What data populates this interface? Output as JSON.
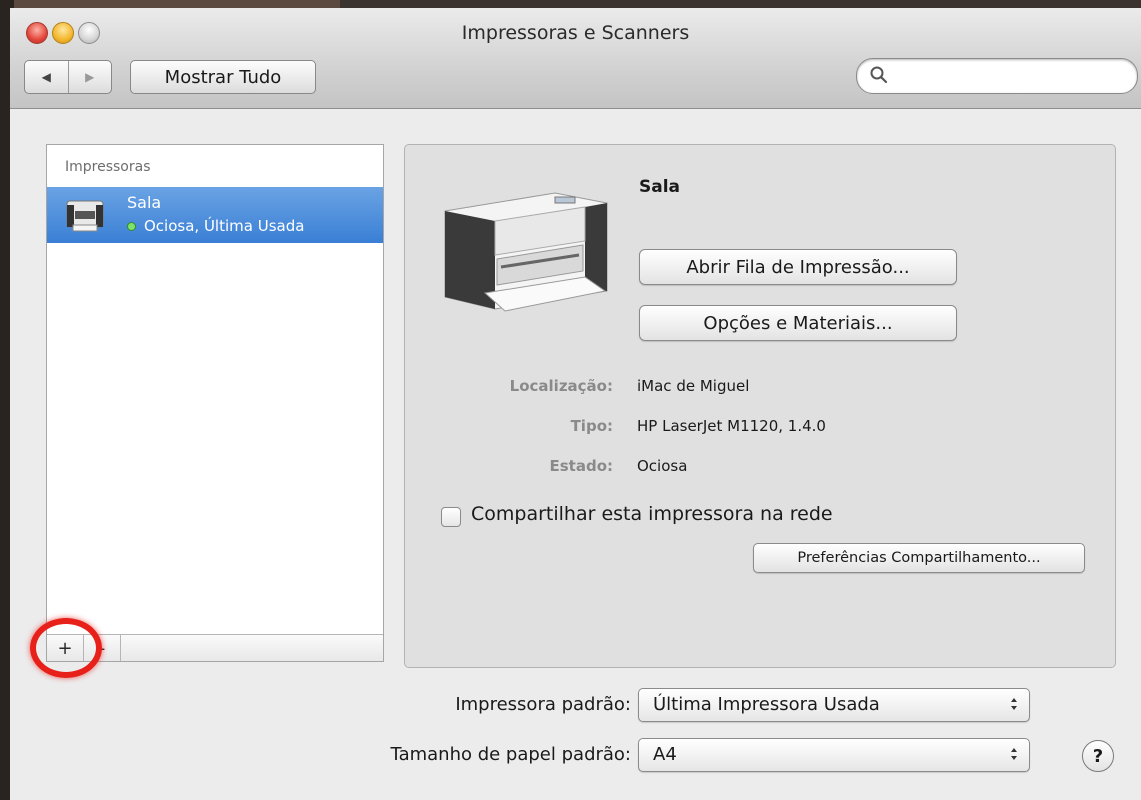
{
  "window": {
    "title": "Impressoras e Scanners"
  },
  "toolbar": {
    "back_icon": "◀",
    "forward_icon": "▶",
    "show_all_label": "Mostrar Tudo",
    "search_placeholder": "",
    "search_value": ""
  },
  "sidebar": {
    "header": "Impressoras",
    "items": [
      {
        "name": "Sala",
        "status": "Ociosa, Última Usada",
        "status_color": "#7ce36a"
      }
    ],
    "add_label": "+",
    "remove_label": "-"
  },
  "detail": {
    "name": "Sala",
    "open_queue_label": "Abrir Fila de Impressão...",
    "options_label": "Opções e Materiais...",
    "info": [
      {
        "label": "Localização:",
        "value": "iMac de Miguel"
      },
      {
        "label": "Tipo:",
        "value": "HP LaserJet M1120, 1.4.0"
      },
      {
        "label": "Estado:",
        "value": "Ociosa"
      }
    ],
    "share_label": "Compartilhar esta impressora na rede",
    "share_checked": false,
    "sharing_prefs_label": "Preferências Compartilhamento..."
  },
  "defaults": {
    "default_printer_label": "Impressora padrão:",
    "default_printer_value": "Última Impressora Usada",
    "paper_size_label": "Tamanho de papel padrão:",
    "paper_size_value": "A4",
    "help_label": "?"
  },
  "colors": {
    "selection": "#3a7fd5",
    "highlight_ring": "#e8201a"
  }
}
